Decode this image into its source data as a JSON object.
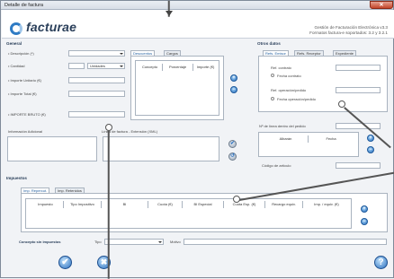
{
  "window": {
    "title": "Detalle de factura",
    "close_label": "✕"
  },
  "header": {
    "logo_text": "facturae",
    "line1": "Gestión de Facturación Electrónica v3.3",
    "line2": "Formatos factura-e soportados: 3.2 y 3.2.1"
  },
  "general": {
    "section_title": "General",
    "descripcion_label": "• Descripción (*)",
    "cantidad_label": "• Cantidad",
    "unidades_value": "Unidades",
    "precio_label": "• Importe Unitario (€)",
    "total_label": "• Importe Total (€)",
    "bruto_label": "• IMPORTE BRUTO (€)",
    "info_label": "Información Adicional",
    "extension_label": "Línea de factura - Extensión (XML)"
  },
  "descuentos": {
    "tab_descuentos": "Descuentos",
    "tab_cargos": "Cargos",
    "col_concepto": "Concepto",
    "col_porcentaje": "Porcentaje",
    "col_importe": "Importe (€)"
  },
  "otros": {
    "section_title": "Otros datos",
    "tabs": [
      "Refs. Emisor",
      "Refs. Receptor",
      "Expediente"
    ],
    "ref_contrato": "Ref. contrato",
    "fecha_contrato": "Fecha contrato",
    "ref_operacion": "Ref. operación/pedido",
    "fecha_operacion": "Fecha operación/pedido",
    "num_linea": "Nº de línea dentro del pedido",
    "col_albaran": "Albarán",
    "col_fecha": "Fecha",
    "codigo_articulo": "Código de artículo"
  },
  "impuestos": {
    "section_title": "Impuestos",
    "tabs": [
      "Imp. Repercut.",
      "Imp. Retenidos"
    ],
    "columns": [
      "Impuesto",
      "Tipo Impositivo",
      "BI",
      "Cuota (€)",
      "BI Especial",
      "Cuota Esp. (€)",
      "Recargo equiv.",
      "Imp. / equiv. (€)"
    ]
  },
  "concepto": {
    "label": "Concepto sin impuestos",
    "tipo_label": "Tipo",
    "motivo_label": "Motivo"
  },
  "buttons": {
    "ok": "✔",
    "cancel": "✖",
    "help": "?",
    "add": "+",
    "remove": "−",
    "apply": "✔",
    "reset": "↺"
  },
  "colors": {
    "accent": "#2f7bc4",
    "title_text": "#2a3f5a"
  }
}
